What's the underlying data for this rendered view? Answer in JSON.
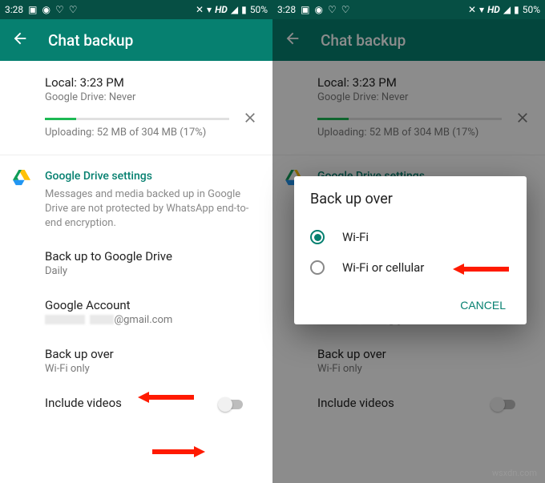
{
  "status": {
    "time": "3:28",
    "battery": "50%",
    "hd": "HD"
  },
  "header": {
    "title": "Chat backup"
  },
  "backup": {
    "local_label": "Local: 3:23 PM",
    "drive_label": "Google Drive: Never",
    "uploading": "Uploading: 52 MB of 304 MB (17%)"
  },
  "gdrive": {
    "head": "Google Drive settings",
    "info": "Messages and media backed up in Google Drive are not protected by WhatsApp end-to-end encryption.",
    "backup_to": {
      "title": "Back up to Google Drive",
      "sub": "Daily"
    },
    "account": {
      "title": "Google Account",
      "sub": "@gmail.com"
    },
    "over": {
      "title": "Back up over",
      "sub": "Wi-Fi only"
    },
    "videos": {
      "title": "Include videos"
    }
  },
  "dialog": {
    "title": "Back up over",
    "opt1": "Wi-Fi",
    "opt2": "Wi-Fi or cellular",
    "cancel": "CANCEL"
  },
  "watermark": "wsxdn.com"
}
